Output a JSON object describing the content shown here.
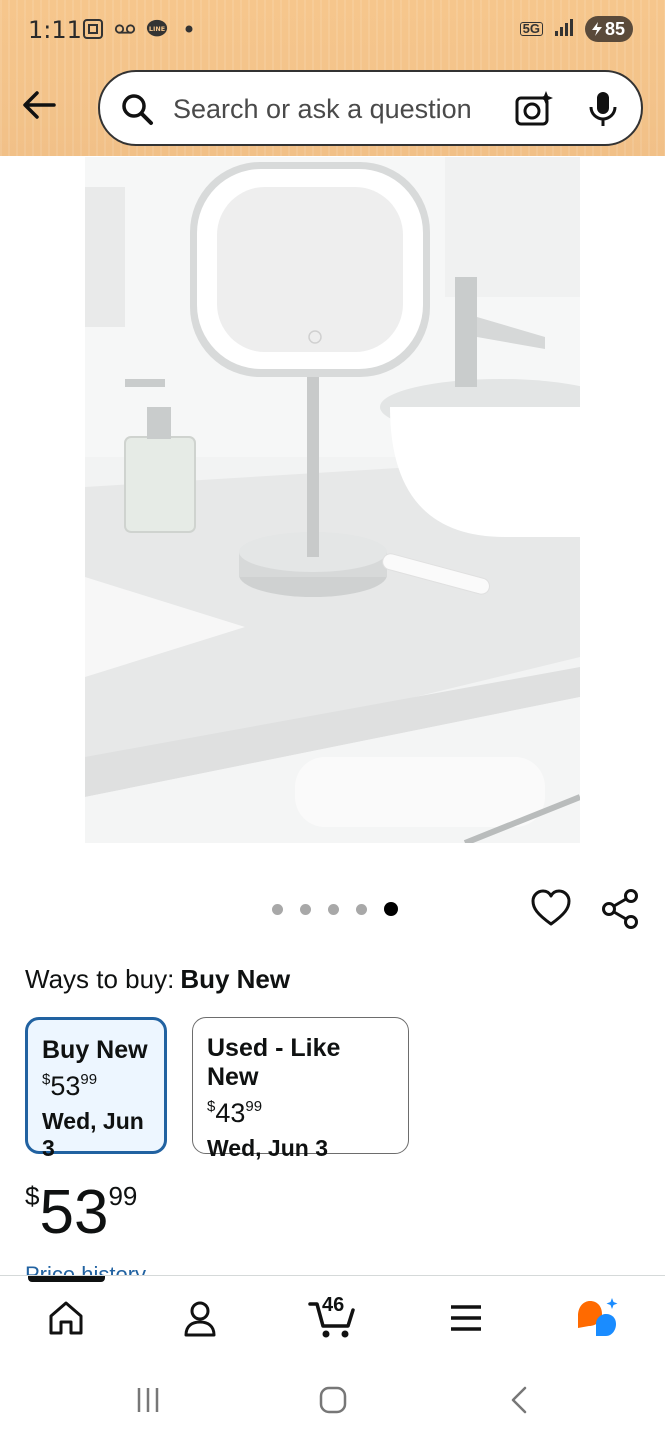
{
  "status_bar": {
    "time": "1:11",
    "network": "5G",
    "battery": "85",
    "icons": [
      "screenshot-icon",
      "voicemail-icon",
      "line-app-icon",
      "dot-icon",
      "signal-icon",
      "battery-icon"
    ]
  },
  "search": {
    "placeholder": "Search or ask a question"
  },
  "carousel": {
    "count": 5,
    "active_index": 4
  },
  "ways_to_buy": {
    "label": "Ways to buy:",
    "selected": "Buy New"
  },
  "options": [
    {
      "title": "Buy New",
      "price_symbol": "$",
      "price_whole": "53",
      "price_fraction": "99",
      "delivery": "Wed, Jun 3"
    },
    {
      "title": "Used - Like New",
      "price_symbol": "$",
      "price_whole": "43",
      "price_fraction": "99",
      "delivery": "Wed, Jun 3"
    }
  ],
  "price": {
    "symbol": "$",
    "whole": "53",
    "fraction": "99"
  },
  "price_history_label": "Price history",
  "bottom_nav": {
    "items": [
      "home-icon",
      "account-icon",
      "cart-icon",
      "menu-icon",
      "rufus-icon"
    ],
    "cart_count": "46"
  },
  "colors": {
    "header_bg": "#f3c38a",
    "accent_blue": "#2162a1",
    "selected_bg": "#edf6ff",
    "rufus_orange": "#ff6a00",
    "rufus_blue": "#1a8cff"
  }
}
